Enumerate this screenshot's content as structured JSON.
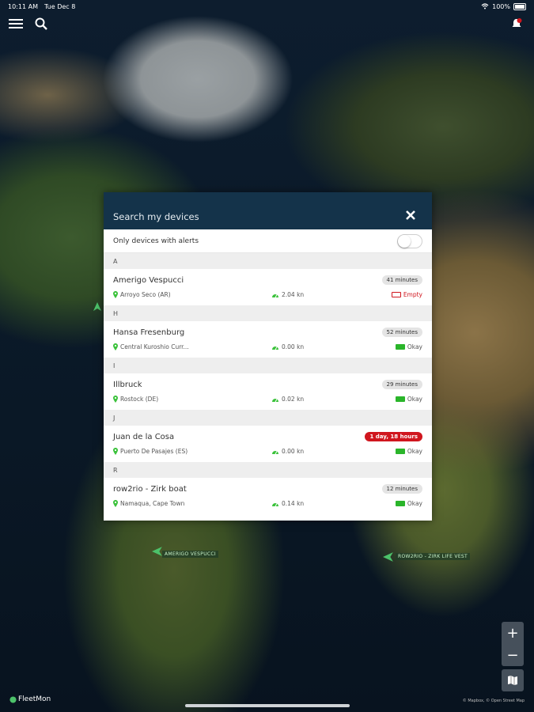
{
  "status_bar": {
    "time": "10:11 AM",
    "date": "Tue Dec 8",
    "battery": "100%"
  },
  "map": {
    "labels": [
      "AMERIGO VESPUCCI",
      "ROW2RIO - ZIRK LIFE VEST"
    ],
    "brand": "FleetMon",
    "attribution": "© Mapbox, © Open Street Map"
  },
  "modal": {
    "title": "Search my devices",
    "filter_label": "Only devices with alerts",
    "sections": [
      {
        "letter": "A",
        "devices": [
          {
            "name": "Amerigo Vespucci",
            "location": "Arroyo Seco (AR)",
            "speed": "2.04 kn",
            "time": "41 minutes",
            "time_alert": false,
            "battery": "Empty",
            "battery_empty": true
          }
        ]
      },
      {
        "letter": "H",
        "devices": [
          {
            "name": "Hansa Fresenburg",
            "location": "Central Kuroshio Curr...",
            "speed": "0.00 kn",
            "time": "52 minutes",
            "time_alert": false,
            "battery": "Okay",
            "battery_empty": false
          }
        ]
      },
      {
        "letter": "I",
        "devices": [
          {
            "name": "Illbruck",
            "location": "Rostock (DE)",
            "speed": "0.02 kn",
            "time": "29 minutes",
            "time_alert": false,
            "battery": "Okay",
            "battery_empty": false
          }
        ]
      },
      {
        "letter": "J",
        "devices": [
          {
            "name": "Juan de la Cosa",
            "location": "Puerto De Pasajes (ES)",
            "speed": "0.00 kn",
            "time": "1 day, 18 hours",
            "time_alert": true,
            "battery": "Okay",
            "battery_empty": false
          }
        ]
      },
      {
        "letter": "R",
        "devices": [
          {
            "name": "row2rio - Zirk boat",
            "location": "Namaqua, Cape Town",
            "speed": "0.14 kn",
            "time": "12 minutes",
            "time_alert": false,
            "battery": "Okay",
            "battery_empty": false
          }
        ]
      }
    ]
  },
  "colors": {
    "header": "#14334a",
    "alert": "#d0161e",
    "ok": "#2ab52a",
    "pin": "#3cc23c"
  }
}
